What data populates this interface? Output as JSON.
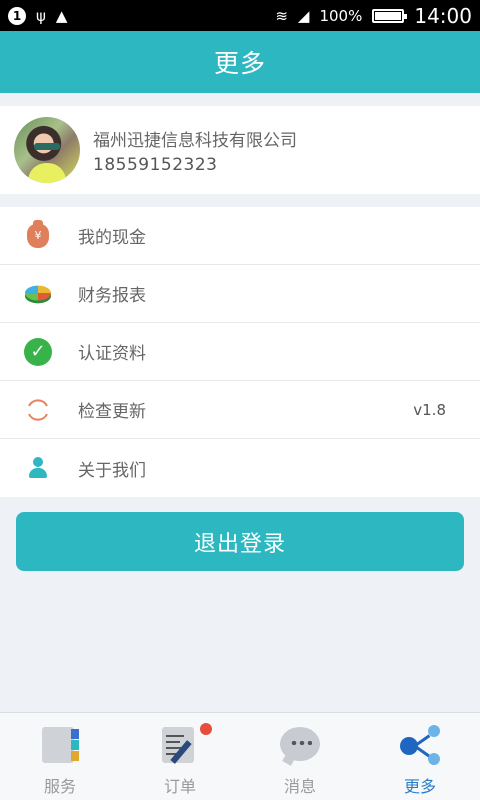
{
  "statusbar": {
    "badge": "1",
    "usb_glyph": "ψ",
    "warning_glyph": "▲",
    "wifi_glyph": "≋",
    "signal_glyph": "◢",
    "battery": "100%",
    "time": "14:00"
  },
  "header": {
    "title": "更多"
  },
  "profile": {
    "company": "福州迅捷信息科技有限公司",
    "phone": "18559152323"
  },
  "menu": {
    "items": [
      {
        "label": "我的现金",
        "icon": "money-bag-icon",
        "money_glyph": "¥"
      },
      {
        "label": "财务报表",
        "icon": "pie-chart-icon"
      },
      {
        "label": "认证资料",
        "icon": "check-circle-icon",
        "check_glyph": "✓"
      },
      {
        "label": "检查更新",
        "icon": "refresh-icon",
        "value": "v1.8"
      },
      {
        "label": "关于我们",
        "icon": "person-icon"
      }
    ]
  },
  "logout": {
    "label": "退出登录"
  },
  "tabbar": {
    "tabs": [
      {
        "label": "服务",
        "icon": "service-card-icon"
      },
      {
        "label": "订单",
        "icon": "order-edit-icon"
      },
      {
        "label": "消息",
        "icon": "message-bubble-icon"
      },
      {
        "label": "更多",
        "icon": "share-nodes-icon",
        "active": true
      }
    ]
  },
  "colors": {
    "accent": "#2db8c1",
    "active_tab": "#2a7ec8",
    "notification": "#e74c3c"
  }
}
